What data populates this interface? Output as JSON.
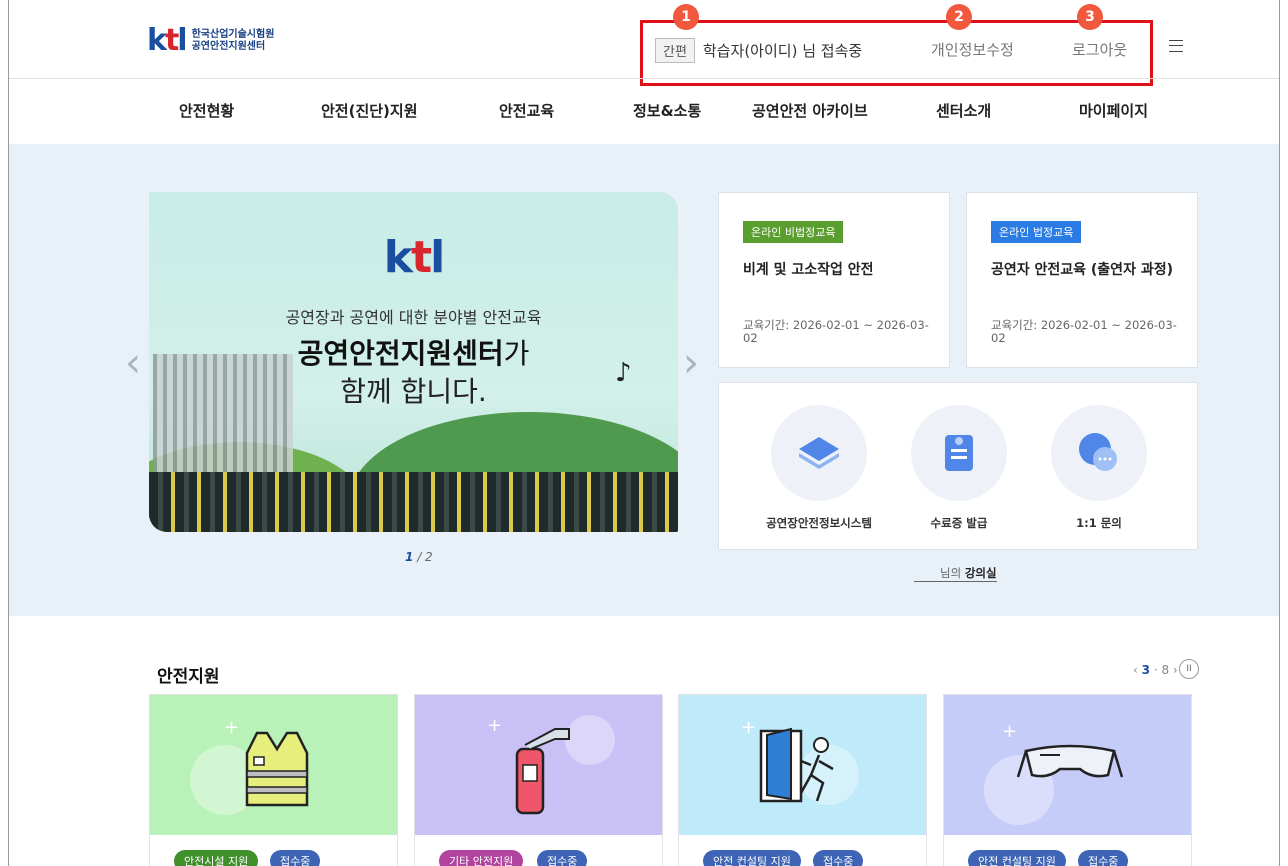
{
  "header": {
    "logo_mark": "ktl",
    "logo_line1": "한국산업기술시험원",
    "logo_line2": "공연안전지원센터",
    "easy_badge": "간편",
    "user_status": "학습자(아이디) 님 접속중",
    "edit_profile": "개인정보수정",
    "logout": "로그아웃",
    "markers": [
      "1",
      "2",
      "3"
    ],
    "menu_icon": "hamburger-icon",
    "highlight_color": "#e0101a",
    "marker_color": "#f2583e"
  },
  "nav": [
    "안전현황",
    "안전(진단)지원",
    "안전교육",
    "정보&소통",
    "공연안전 아카이브",
    "센터소개",
    "마이페이지"
  ],
  "banner": {
    "logo": "ktl",
    "line1": "공연장과 공연에 대한 분야별 안전교육",
    "line2_bold": "공연안전지원센터",
    "line2_rest": "가",
    "line3": "함께 합니다.",
    "page_current": "1",
    "page_total": "/ 2",
    "prev_icon": "chevron-left-icon",
    "next_icon": "chevron-right-icon"
  },
  "courses": [
    {
      "tag": "온라인 비법정교육",
      "tag_color": "#5a9e2f",
      "title": "비계 및 고소작업 안전",
      "period": "교육기간: 2026-02-01 ~ 2026-03-02"
    },
    {
      "tag": "온라인 법정교육",
      "tag_color": "#2b7be4",
      "title": "공연자 안전교육 (출연자 과정)",
      "period": "교육기간: 2026-02-01 ~ 2026-03-02"
    }
  ],
  "quick_links": [
    {
      "label": "공연장안전정보시스템",
      "icon": "system-icon"
    },
    {
      "label": "수료증 발급",
      "icon": "certificate-icon"
    },
    {
      "label": "1:1 문의",
      "icon": "chat-icon"
    }
  ],
  "classroom": {
    "prefix": "님의 ",
    "bold": "강의실"
  },
  "safety": {
    "title": "안전지원",
    "pager_current": "3",
    "pager_total": "· 8",
    "pager_prev": "‹",
    "pager_next": "›",
    "pause": "II",
    "cards": [
      {
        "bg": "#b9f2b8",
        "icon": "safety-vest-icon",
        "pill1": "안전시설 지원",
        "pill1_color": "#3f8f2b",
        "pill2": "접수중"
      },
      {
        "bg": "#c9c0f6",
        "icon": "fire-extinguisher-icon",
        "pill1": "기타 안전지원",
        "pill1_color": "#b0449e",
        "pill2": "접수중"
      },
      {
        "bg": "#bfeaf9",
        "icon": "emergency-exit-icon",
        "pill1": "안전 컨설팅 지원",
        "pill1_color": "#3e64b5",
        "pill2": "접수중"
      },
      {
        "bg": "#c6ccf8",
        "icon": "safety-goggles-icon",
        "pill1": "안전 컨설팅 지원",
        "pill1_color": "#3e64b5",
        "pill2": "접수중"
      }
    ]
  }
}
